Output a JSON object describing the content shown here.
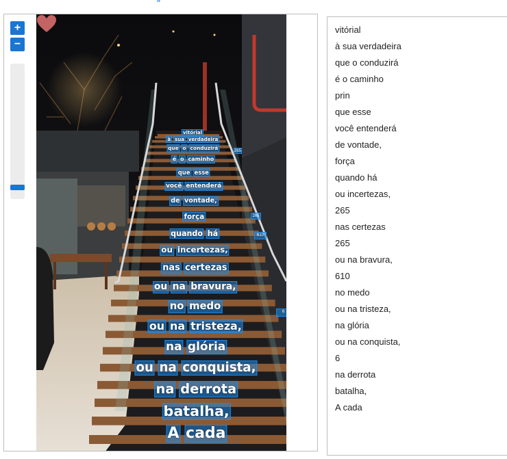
{
  "top_link_fragment": "g",
  "viewer": {
    "zoom_in_label": "+",
    "zoom_out_label": "−",
    "zoom_level": 0.93
  },
  "image_overlay": {
    "lines": [
      {
        "words": [
          "vitórial"
        ]
      },
      {
        "words": [
          "à",
          "sua",
          "verdadeira"
        ]
      },
      {
        "words": [
          "que",
          "o",
          "conduzirá"
        ]
      },
      {
        "words": [
          "é",
          "o",
          "caminho"
        ]
      },
      {
        "words": [
          "que",
          "esse"
        ]
      },
      {
        "words": [
          "você",
          "entenderá"
        ]
      },
      {
        "words": [
          "de",
          "vontade,"
        ]
      },
      {
        "words": [
          "força"
        ]
      },
      {
        "words": [
          "quando",
          "há"
        ]
      },
      {
        "words": [
          "ou",
          "incertezas,"
        ]
      },
      {
        "words": [
          "nas",
          "certezas"
        ]
      },
      {
        "words": [
          "ou",
          "na",
          "bravura,"
        ]
      },
      {
        "words": [
          "no",
          "medo"
        ]
      },
      {
        "words": [
          "ou",
          "na",
          "tristeza,"
        ]
      },
      {
        "words": [
          "na",
          "glória"
        ]
      },
      {
        "words": [
          "ou",
          "na",
          "conquista,"
        ]
      },
      {
        "words": [
          "na",
          "derrota"
        ]
      },
      {
        "words": [
          "batalha,"
        ]
      },
      {
        "words": [
          "A",
          "cada"
        ]
      }
    ],
    "side_words": [
      "265",
      "265",
      "610",
      "6"
    ]
  },
  "results": {
    "lines": [
      "vitórial",
      "à sua verdadeira",
      "que o conduzirá",
      "é o caminho",
      "prin",
      "que esse",
      "você entenderá",
      "de vontade,",
      "força",
      "quando há",
      "ou incertezas,",
      "265",
      "nas certezas",
      "265",
      "ou na bravura,",
      "610",
      "no medo",
      "ou na tristeza,",
      "na glória",
      "ou na conquista,",
      "6",
      "na derrota",
      "batalha,",
      "A cada"
    ]
  },
  "colors": {
    "accent": "#1976d2",
    "box_fill": "#1e88e5",
    "stair_wood": "#8a5a35",
    "stair_dark": "#1c1c1e"
  },
  "icons": {
    "heart": "heart-icon"
  }
}
